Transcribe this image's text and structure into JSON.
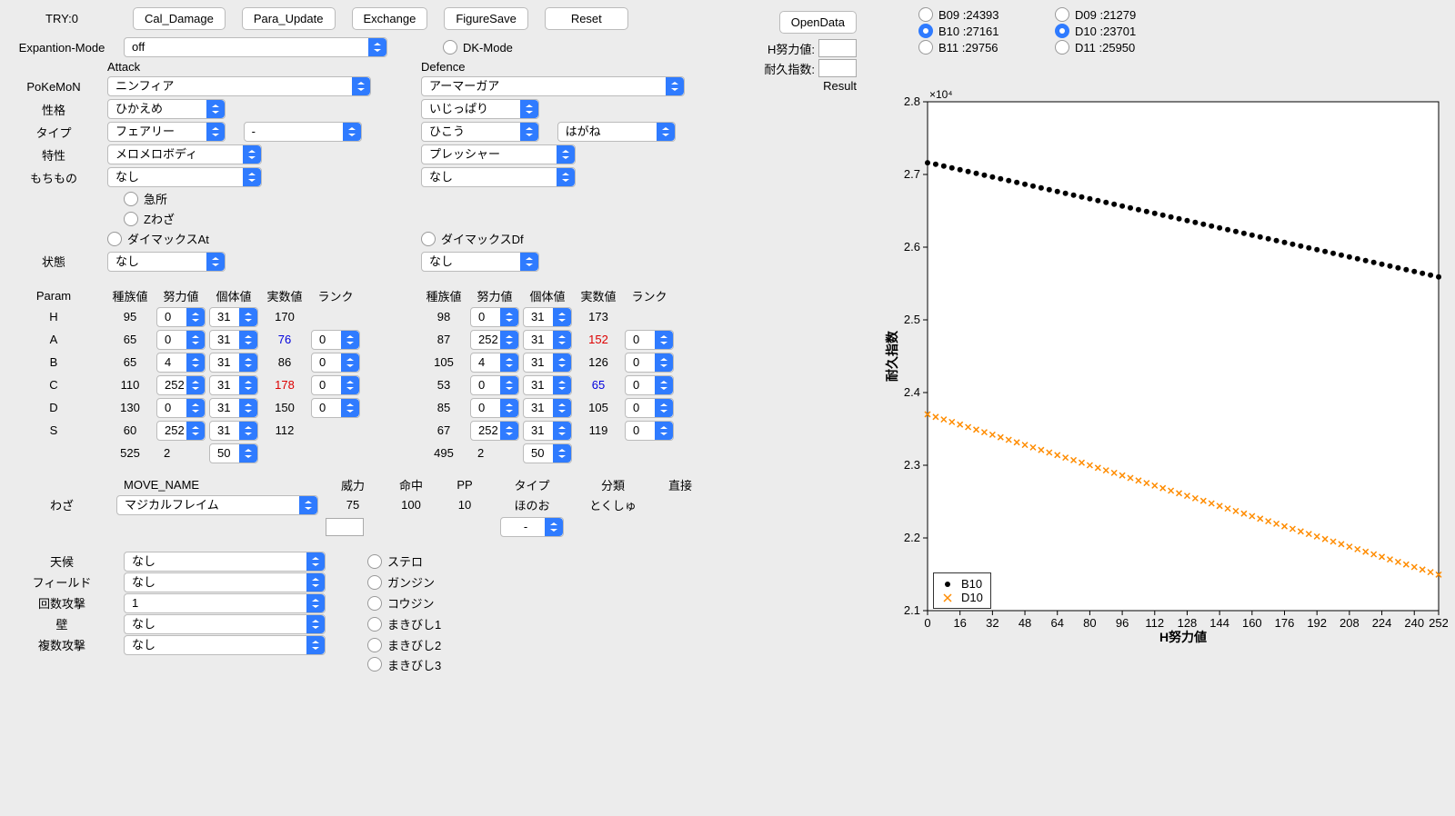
{
  "header": {
    "try_label": "TRY:0",
    "buttons": [
      "Cal_Damage",
      "Para_Update",
      "Exchange",
      "FigureSave",
      "Reset"
    ],
    "expansion_label": "Expantion-Mode",
    "expansion_value": "off",
    "dk_mode": "DK-Mode"
  },
  "labels": {
    "attack": "Attack",
    "defence": "Defence",
    "pokemon": "PoKeMoN",
    "seikaku": "性格",
    "type": "タイプ",
    "tokusei": "特性",
    "mochimono": "もちもの",
    "kyusho": "急所",
    "zwaza": "Zわざ",
    "dymax_at": "ダイマックスAt",
    "dymax_df": "ダイマックスDf",
    "joutai": "状態",
    "param": "Param",
    "waza": "わざ",
    "tenkou": "天候",
    "field": "フィールド",
    "kaisuu": "回数攻撃",
    "kabe": "壁",
    "fukusuu": "複数攻撃",
    "open_data": "OpenData",
    "h_doryoku": "H努力値:",
    "taikyuu": "耐久指数:",
    "result": "Result"
  },
  "attack": {
    "pokemon": "ニンフィア",
    "seikaku": "ひかえめ",
    "type1": "フェアリー",
    "type2": "-",
    "tokusei": "メロメロボディ",
    "mochimono": "なし",
    "joutai": "なし"
  },
  "defence": {
    "pokemon": "アーマーガア",
    "seikaku": "いじっぱり",
    "type1": "ひこう",
    "type2": "はがね",
    "tokusei": "プレッシャー",
    "mochimono": "なし",
    "joutai": "なし"
  },
  "param_headers": [
    "種族値",
    "努力値",
    "個体値",
    "実数値",
    "ランク"
  ],
  "param_stats": [
    "H",
    "A",
    "B",
    "C",
    "D",
    "S"
  ],
  "attack_params": {
    "H": {
      "base": "95",
      "ev": "0",
      "iv": "31",
      "real": "170",
      "rank": ""
    },
    "A": {
      "base": "65",
      "ev": "0",
      "iv": "31",
      "real": "76",
      "rank": "0",
      "real_color": "blue"
    },
    "B": {
      "base": "65",
      "ev": "4",
      "iv": "31",
      "real": "86",
      "rank": "0"
    },
    "C": {
      "base": "110",
      "ev": "252",
      "iv": "31",
      "real": "178",
      "rank": "0",
      "real_color": "red"
    },
    "D": {
      "base": "130",
      "ev": "0",
      "iv": "31",
      "real": "150",
      "rank": "0"
    },
    "S": {
      "base": "60",
      "ev": "252",
      "iv": "31",
      "real": "112",
      "rank": ""
    },
    "total_base": "525",
    "total_ev": "2",
    "level": "50"
  },
  "defence_params": {
    "H": {
      "base": "98",
      "ev": "0",
      "iv": "31",
      "real": "173",
      "rank": ""
    },
    "A": {
      "base": "87",
      "ev": "252",
      "iv": "31",
      "real": "152",
      "rank": "0",
      "real_color": "red"
    },
    "B": {
      "base": "105",
      "ev": "4",
      "iv": "31",
      "real": "126",
      "rank": "0"
    },
    "C": {
      "base": "53",
      "ev": "0",
      "iv": "31",
      "real": "65",
      "rank": "0",
      "real_color": "blue"
    },
    "D": {
      "base": "85",
      "ev": "0",
      "iv": "31",
      "real": "105",
      "rank": "0"
    },
    "S": {
      "base": "67",
      "ev": "252",
      "iv": "31",
      "real": "119",
      "rank": "0"
    },
    "total_base": "495",
    "total_ev": "2",
    "level": "50"
  },
  "move": {
    "header_name": "MOVE_NAME",
    "headers": [
      "威力",
      "命中",
      "PP",
      "タイプ",
      "分類",
      "直接"
    ],
    "name": "マジカルフレイム",
    "power": "75",
    "acc": "100",
    "pp": "10",
    "type": "ほのお",
    "category": "とくしゅ",
    "direct": "",
    "type_override": "-"
  },
  "env": {
    "tenkou": "なし",
    "field": "なし",
    "kaisuu": "1",
    "kabe": "なし",
    "fukusuu": "なし",
    "hazards": [
      "ステロ",
      "ガンジン",
      "コウジン",
      "まきびし1",
      "まきびし2",
      "まきびし3"
    ]
  },
  "right_panel": {
    "radios": [
      {
        "label": "B09 :24393",
        "on": false
      },
      {
        "label": "D09 :21279",
        "on": false
      },
      {
        "label": "B10 :27161",
        "on": true
      },
      {
        "label": "D10 :23701",
        "on": true
      },
      {
        "label": "B11 :29756",
        "on": false
      },
      {
        "label": "D11 :25950",
        "on": false
      }
    ],
    "h_doryoku_val": "",
    "taikyuu_val": ""
  },
  "chart_data": {
    "type": "scatter",
    "xlabel": "H努力値",
    "ylabel": "耐久指数",
    "y_exponent": "×10⁴",
    "xlim": [
      0,
      252
    ],
    "ylim": [
      21000,
      28000
    ],
    "xticks": [
      0,
      16,
      32,
      48,
      64,
      80,
      96,
      112,
      128,
      144,
      160,
      176,
      192,
      208,
      224,
      240,
      252
    ],
    "yticks": [
      21000,
      22000,
      23000,
      24000,
      25000,
      26000,
      27000,
      28000
    ],
    "ytick_labels": [
      "2.1",
      "2.2",
      "2.3",
      "2.4",
      "2.5",
      "2.6",
      "2.7",
      "2.8"
    ],
    "legend": [
      "B10",
      "D10"
    ],
    "series": [
      {
        "name": "B10",
        "marker": "circle",
        "color": "#000000",
        "x": [
          0,
          4,
          8,
          12,
          16,
          20,
          24,
          28,
          32,
          36,
          40,
          44,
          48,
          52,
          56,
          60,
          64,
          68,
          72,
          76,
          80,
          84,
          88,
          92,
          96,
          100,
          104,
          108,
          112,
          116,
          120,
          124,
          128,
          132,
          136,
          140,
          144,
          148,
          152,
          156,
          160,
          164,
          168,
          172,
          176,
          180,
          184,
          188,
          192,
          196,
          200,
          204,
          208,
          212,
          216,
          220,
          224,
          228,
          232,
          236,
          240,
          244,
          248,
          252
        ],
        "y": [
          27161,
          27140,
          27115,
          27090,
          27065,
          27040,
          27015,
          26990,
          26965,
          26940,
          26915,
          26890,
          26865,
          26840,
          26815,
          26790,
          26765,
          26740,
          26715,
          26690,
          26665,
          26640,
          26615,
          26590,
          26565,
          26540,
          26515,
          26490,
          26465,
          26440,
          26415,
          26390,
          26365,
          26340,
          26315,
          26290,
          26265,
          26240,
          26215,
          26190,
          26165,
          26140,
          26115,
          26090,
          26065,
          26040,
          26015,
          25990,
          25965,
          25940,
          25915,
          25890,
          25865,
          25840,
          25815,
          25790,
          25765,
          25740,
          25715,
          25690,
          25665,
          25640,
          25615,
          25590
        ]
      },
      {
        "name": "D10",
        "marker": "x",
        "color": "#ff8c00",
        "x": [
          0,
          4,
          8,
          12,
          16,
          20,
          24,
          28,
          32,
          36,
          40,
          44,
          48,
          52,
          56,
          60,
          64,
          68,
          72,
          76,
          80,
          84,
          88,
          92,
          96,
          100,
          104,
          108,
          112,
          116,
          120,
          124,
          128,
          132,
          136,
          140,
          144,
          148,
          152,
          156,
          160,
          164,
          168,
          172,
          176,
          180,
          184,
          188,
          192,
          196,
          200,
          204,
          208,
          212,
          216,
          220,
          224,
          228,
          232,
          236,
          240,
          244,
          248,
          252
        ],
        "y": [
          23701,
          23665,
          23630,
          23595,
          23560,
          23525,
          23490,
          23455,
          23420,
          23385,
          23350,
          23315,
          23280,
          23245,
          23210,
          23175,
          23140,
          23105,
          23070,
          23035,
          23000,
          22965,
          22930,
          22895,
          22860,
          22825,
          22790,
          22755,
          22720,
          22685,
          22650,
          22615,
          22580,
          22545,
          22510,
          22475,
          22440,
          22405,
          22370,
          22335,
          22300,
          22265,
          22230,
          22195,
          22160,
          22125,
          22090,
          22055,
          22020,
          21985,
          21950,
          21915,
          21880,
          21845,
          21810,
          21775,
          21740,
          21705,
          21670,
          21635,
          21600,
          21565,
          21530,
          21495
        ]
      }
    ]
  }
}
